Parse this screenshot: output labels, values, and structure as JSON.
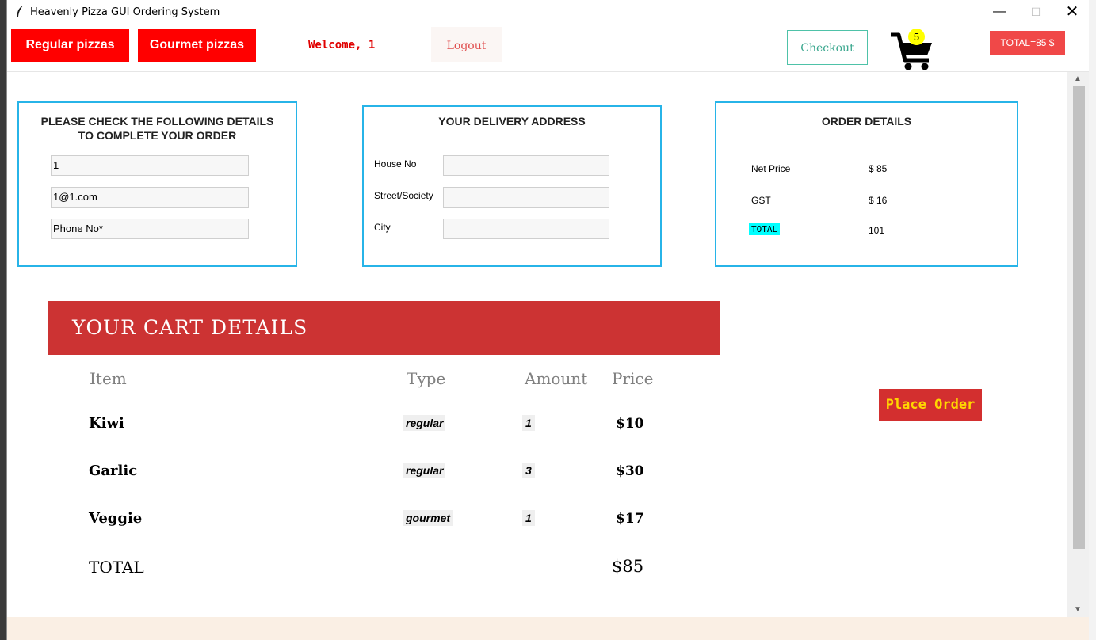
{
  "window": {
    "title": "Heavenly Pizza GUI Ordering System"
  },
  "topbar": {
    "regular_label": "Regular pizzas",
    "gourmet_label": "Gourmet pizzas",
    "welcome_text": "Welcome, 1",
    "logout_label": "Logout",
    "checkout_label": "Checkout",
    "cart_count": "5",
    "total_label": "TOTAL=85 $"
  },
  "details_panel": {
    "title_line1": "PLEASE CHECK THE FOLLOWING DETAILS",
    "title_line2": "TO COMPLETE YOUR ORDER",
    "name_value": "1",
    "email_value": "1@1.com",
    "phone_value": "Phone No*"
  },
  "address_panel": {
    "title": "YOUR DELIVERY ADDRESS",
    "house_label": "House No",
    "street_label": "Street/Society",
    "city_label": "City"
  },
  "order_panel": {
    "title": "ORDER DETAILS",
    "net_label": "Net Price",
    "net_value": "$ 85",
    "gst_label": "GST",
    "gst_value": "$ 16",
    "total_label": "TOTAL",
    "total_value": "101"
  },
  "cart": {
    "banner": "YOUR CART DETAILS",
    "headers": {
      "item": "Item",
      "type": "Type",
      "amount": "Amount",
      "price": "Price"
    },
    "rows": [
      {
        "item": "Kiwi",
        "type": "regular",
        "amount": "1",
        "price": "$10"
      },
      {
        "item": "Garlic",
        "type": "regular",
        "amount": "3",
        "price": "$30"
      },
      {
        "item": "Veggie",
        "type": "gourmet",
        "amount": "1",
        "price": "$17"
      }
    ],
    "total_label": "TOTAL",
    "total_value": "$85"
  },
  "place_order_label": "Place Order",
  "colors": {
    "red_button": "#ff0000",
    "panel_border": "#27b4e8",
    "banner": "#cc3333",
    "place_order": "#d32f2f",
    "place_order_text": "#ffd700",
    "total_highlight": "#00ffff",
    "cart_badge": "#ffff00",
    "checkout_border": "#4ec2a8"
  }
}
